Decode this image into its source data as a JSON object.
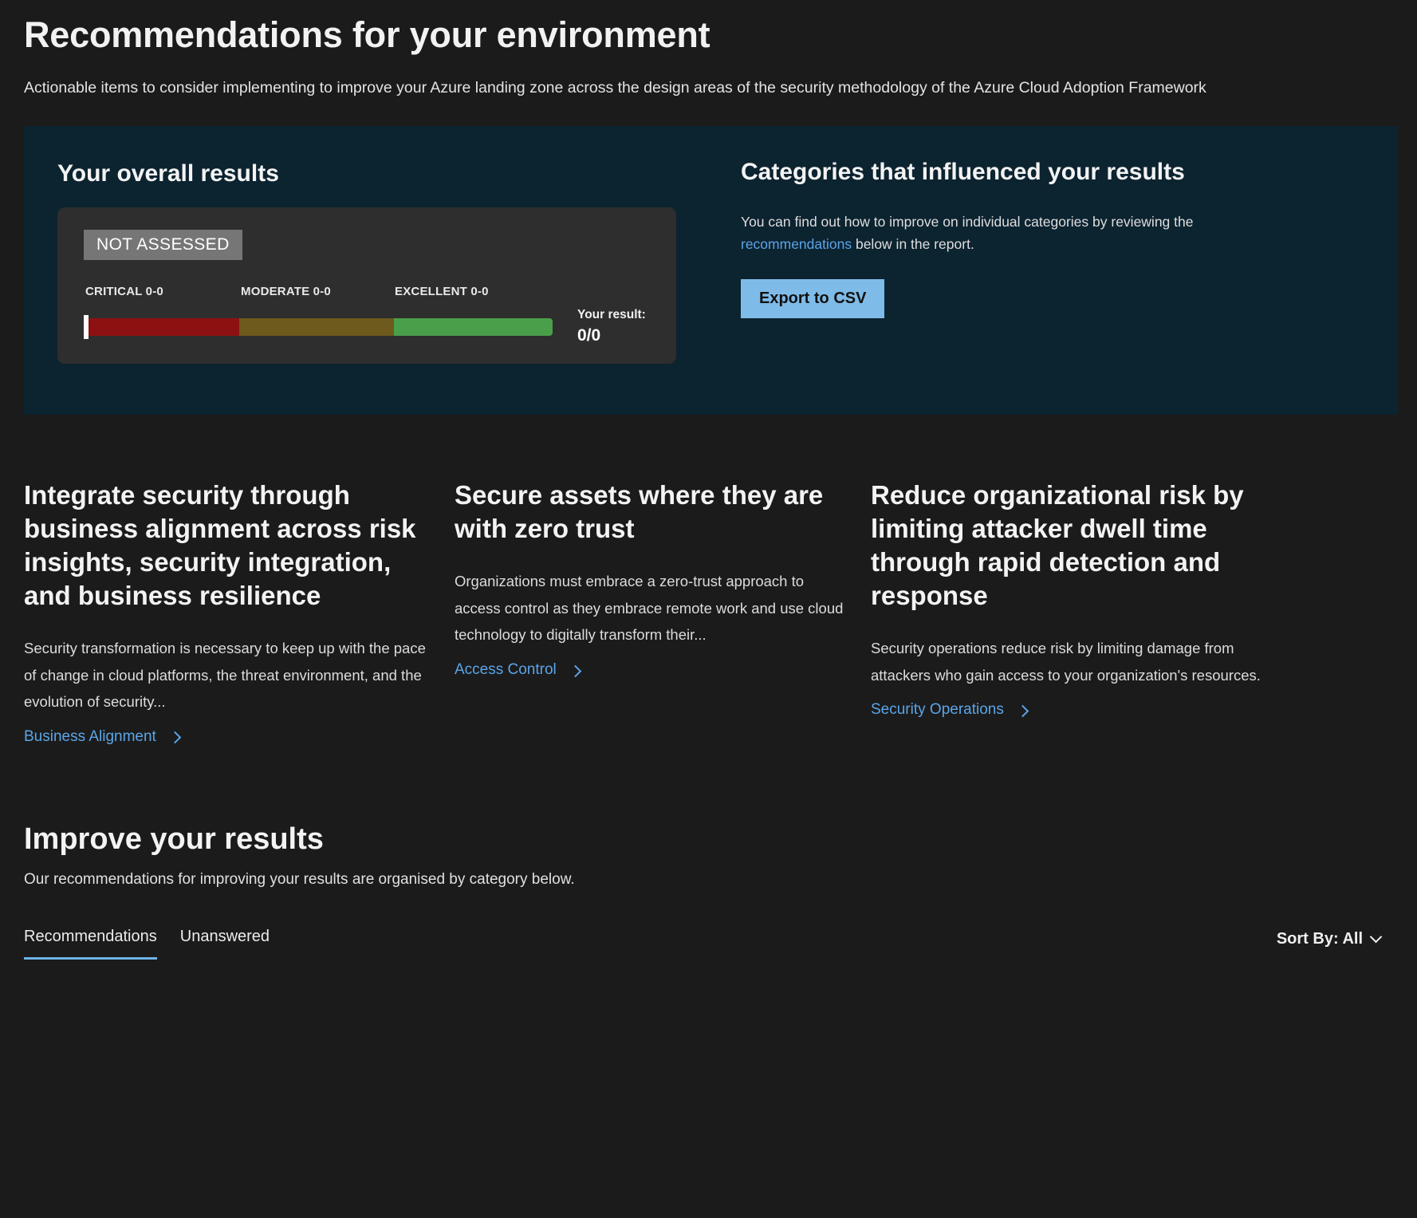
{
  "header": {
    "title": "Recommendations for your environment",
    "subtitle": "Actionable items to consider implementing to improve your Azure landing zone across the design areas of the security methodology of the Azure Cloud Adoption Framework"
  },
  "results_panel": {
    "left": {
      "heading": "Your overall results",
      "badge": "NOT ASSESSED",
      "scale": {
        "critical": "CRITICAL 0-0",
        "moderate": "MODERATE 0-0",
        "excellent": "EXCELLENT 0-0"
      },
      "result_label": "Your result:",
      "result_value": "0/0",
      "colors": {
        "critical": "#8e1111",
        "moderate": "#6d5a1c",
        "excellent": "#4a9f4a",
        "badge": "#767676",
        "marker": "#ffffff"
      }
    },
    "right": {
      "heading": "Categories that influenced your results",
      "body_before": "You can find out how to improve on individual categories by reviewing the ",
      "body_link": "recommendations",
      "body_after": " below in the report.",
      "export_button": "Export to CSV",
      "export_button_color": "#7fbbe8"
    }
  },
  "features": [
    {
      "title": "Integrate security through business alignment across risk insights, security integration, and business resilience",
      "description": "Security transformation is necessary to keep up with the pace of change in cloud platforms, the threat environment, and the evolution of security...",
      "link": "Business Alignment"
    },
    {
      "title": "Secure assets where they are with zero trust",
      "description": "Organizations must embrace a zero-trust approach to access control as they embrace remote work and use cloud technology to digitally transform their...",
      "link": "Access Control"
    },
    {
      "title": "Reduce organizational risk by limiting attacker dwell time through rapid detection and response",
      "description": "Security operations reduce risk by limiting damage from attackers who gain access to your organization's resources.",
      "link": "Security Operations"
    }
  ],
  "improve": {
    "title": "Improve your results",
    "subtitle": "Our recommendations for improving your results are organised by category below.",
    "tabs": [
      {
        "label": "Recommendations",
        "active": true
      },
      {
        "label": "Unanswered",
        "active": false
      }
    ],
    "sort_by": "Sort By: All",
    "accent": "#6eb4e8"
  }
}
